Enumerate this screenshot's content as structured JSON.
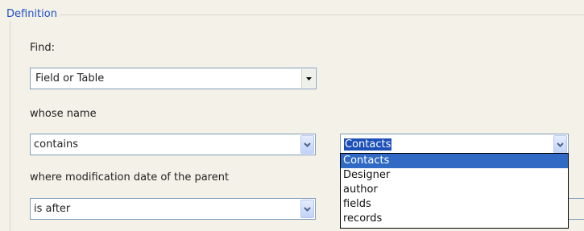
{
  "definition": {
    "legend": "Definition",
    "find_label": "Find:",
    "find_combo": {
      "value": "Field or Table"
    },
    "whose_name_label": "whose name",
    "name_operator_combo": {
      "value": "contains"
    },
    "name_value_combo": {
      "value": "Contacts",
      "options": [
        "Contacts",
        "Designer",
        "author",
        "fields",
        "records"
      ],
      "selected_index": 0
    },
    "modification_label": "where modification date of the parent",
    "date_operator_combo": {
      "value": "is after"
    }
  },
  "icons": {
    "classic_arrow": "triangle-down-icon",
    "xp_arrow": "chevron-down-icon"
  },
  "colors": {
    "legend_text": "#1f4fc9",
    "selection": "#316ac5",
    "background": "#f4f2e8"
  }
}
